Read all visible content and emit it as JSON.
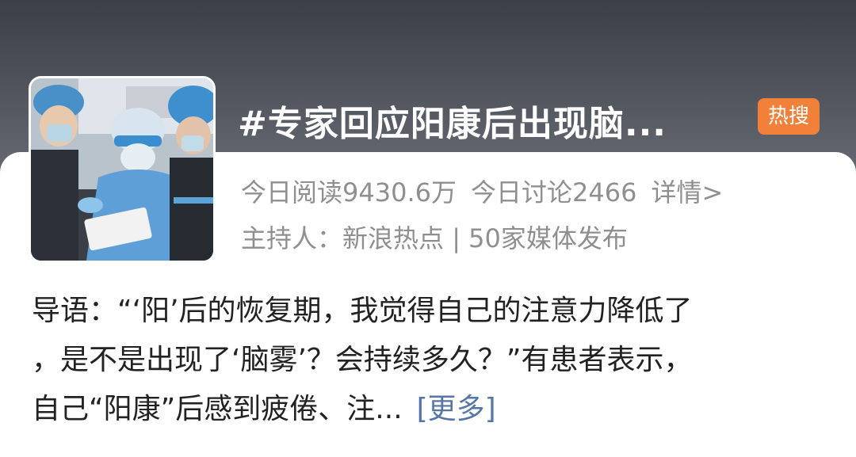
{
  "topic": {
    "title": "#专家回应阳康后出现脑...",
    "badge": "热搜"
  },
  "stats": {
    "reads": "今日阅读9430.6万",
    "discussions": "今日讨论2466",
    "details_link": "详情>"
  },
  "host_line": {
    "label": "主持人：",
    "host": "新浪热点",
    "separator": " | ",
    "media_count": "50家媒体发布"
  },
  "summary": {
    "line1": "导语：“‘阳’后的恢复期，我觉得自己的注意力降低了",
    "line2": "，是不是出现了‘脑雾’？会持续多久？”有患者表示，",
    "line3": "自己“阳康”后感到疲倦、注...",
    "more_link": "[更多]"
  },
  "colors": {
    "header_bg": "#4a4f57",
    "badge_orange": "#f0803a",
    "link_blue": "#5776a8",
    "muted_gray": "#8f8f8f"
  },
  "thumbnail": {
    "icon": "medical-staff-photo"
  }
}
